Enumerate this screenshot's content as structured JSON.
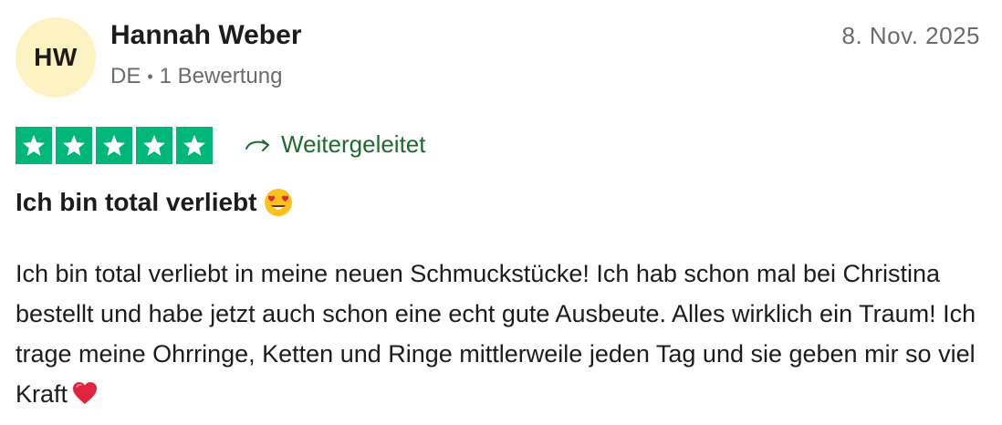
{
  "author": {
    "initials": "HW",
    "name": "Hannah Weber",
    "country": "DE",
    "separator": "•",
    "review_count": "1 Bewertung"
  },
  "date": "8. Nov. 2025",
  "rating": {
    "stars": 5,
    "max": 5,
    "color": "#00b67a"
  },
  "redirect_label": "Weitergeleitet",
  "title": "Ich bin total verliebt",
  "title_emoji": "smiling-face-with-heart-eyes",
  "body": "Ich bin total verliebt in meine neuen Schmuckstücke! Ich hab schon mal bei Christina bestellt und habe jetzt auch schon eine echt gute Ausbeute. Alles wirklich ein Traum! Ich trage meine Ohrringe, Ketten und Ringe mittlerweile jeden Tag und sie geben mir so viel Kraft",
  "body_emoji": "red-heart",
  "colors": {
    "avatar_bg": "#fdf2c2",
    "redirect_text": "#1d6b2e",
    "meta_text": "#6b6b6b"
  }
}
